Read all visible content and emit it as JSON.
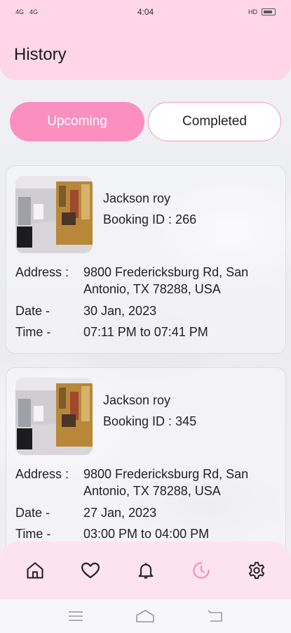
{
  "status_bar": {
    "time": "4:04",
    "signal_left": "4G",
    "signal_right": "4G",
    "right_indicator": "HD"
  },
  "header": {
    "title": "History"
  },
  "tabs": [
    {
      "label": "Upcoming",
      "active": true
    },
    {
      "label": "Completed",
      "active": false
    }
  ],
  "bookings": [
    {
      "name": "Jackson roy",
      "booking_id": "Booking ID : 266",
      "address_label": "Address :",
      "address_line1": "9800 Fredericksburg Rd, San",
      "address_line2": "Antonio, TX 78288, USA",
      "date_label": "Date -",
      "date": "30 Jan, 2023",
      "time_label": "Time -",
      "time": "07:11 PM to 07:41 PM"
    },
    {
      "name": "Jackson roy",
      "booking_id": "Booking ID : 345",
      "address_label": "Address :",
      "address_line1": "9800 Fredericksburg Rd, San",
      "address_line2": "Antonio, TX 78288, USA",
      "date_label": "Date -",
      "date": "27 Jan, 2023",
      "time_label": "Time -",
      "time": "03:00 PM to 04:00 PM"
    }
  ],
  "bottom_nav": [
    {
      "icon": "home-icon",
      "active": false
    },
    {
      "icon": "heart-icon",
      "active": false
    },
    {
      "icon": "bell-icon",
      "active": false
    },
    {
      "icon": "history-icon",
      "active": true
    },
    {
      "icon": "settings-icon",
      "active": false
    }
  ],
  "colors": {
    "accent": "#fb8fbf",
    "header_bg": "#ffd6e6",
    "nav_bg": "#fde3ef",
    "active_icon": "#f48fbd"
  }
}
